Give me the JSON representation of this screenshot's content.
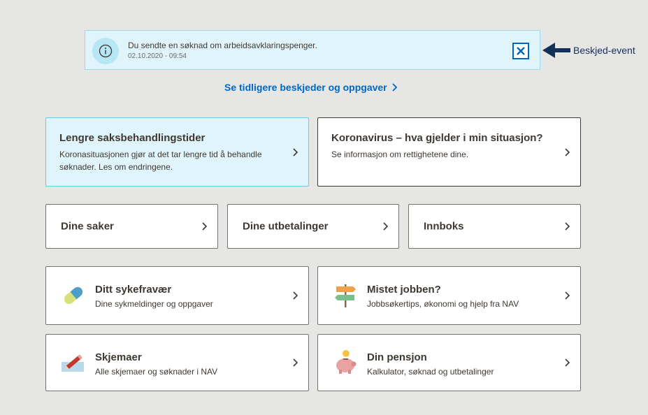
{
  "notification": {
    "message": "Du sendte en søknad om arbeidsavklaringspenger.",
    "datetime": "02.10.2020 - 09:54",
    "icon": "info-icon",
    "close_icon": "close-icon"
  },
  "annotation": {
    "label": "Beskjed-event"
  },
  "older_link": {
    "label": "Se tidligere beskjeder og oppgaver"
  },
  "featured": [
    {
      "title": "Lengre saksbehandlingstider",
      "description": "Koronasituasjonen gjør at det tar lengre tid å behandle søknader. Les om endringene."
    },
    {
      "title": "Koronavirus – hva gjelder i min situasjon?",
      "description": "Se informasjon om rettighetene dine."
    }
  ],
  "quick_links": [
    {
      "label": "Dine saker"
    },
    {
      "label": "Dine utbetalinger"
    },
    {
      "label": "Innboks"
    }
  ],
  "services": [
    {
      "title": "Ditt sykefravær",
      "description": "Dine sykmeldinger og oppgaver",
      "icon": "pill-icon"
    },
    {
      "title": "Mistet jobben?",
      "description": "Jobbsøkertips, økonomi og hjelp fra NAV",
      "icon": "signpost-icon"
    },
    {
      "title": "Skjemaer",
      "description": "Alle skjemaer og søknader i NAV",
      "icon": "pencil-form-icon"
    },
    {
      "title": "Din pensjon",
      "description": "Kalkulator, søknad og utbetalinger",
      "icon": "piggy-bank-icon"
    }
  ],
  "colors": {
    "accent": "#0067c5",
    "background": "#e6e6e5",
    "info_bg": "#e0f5fb"
  }
}
